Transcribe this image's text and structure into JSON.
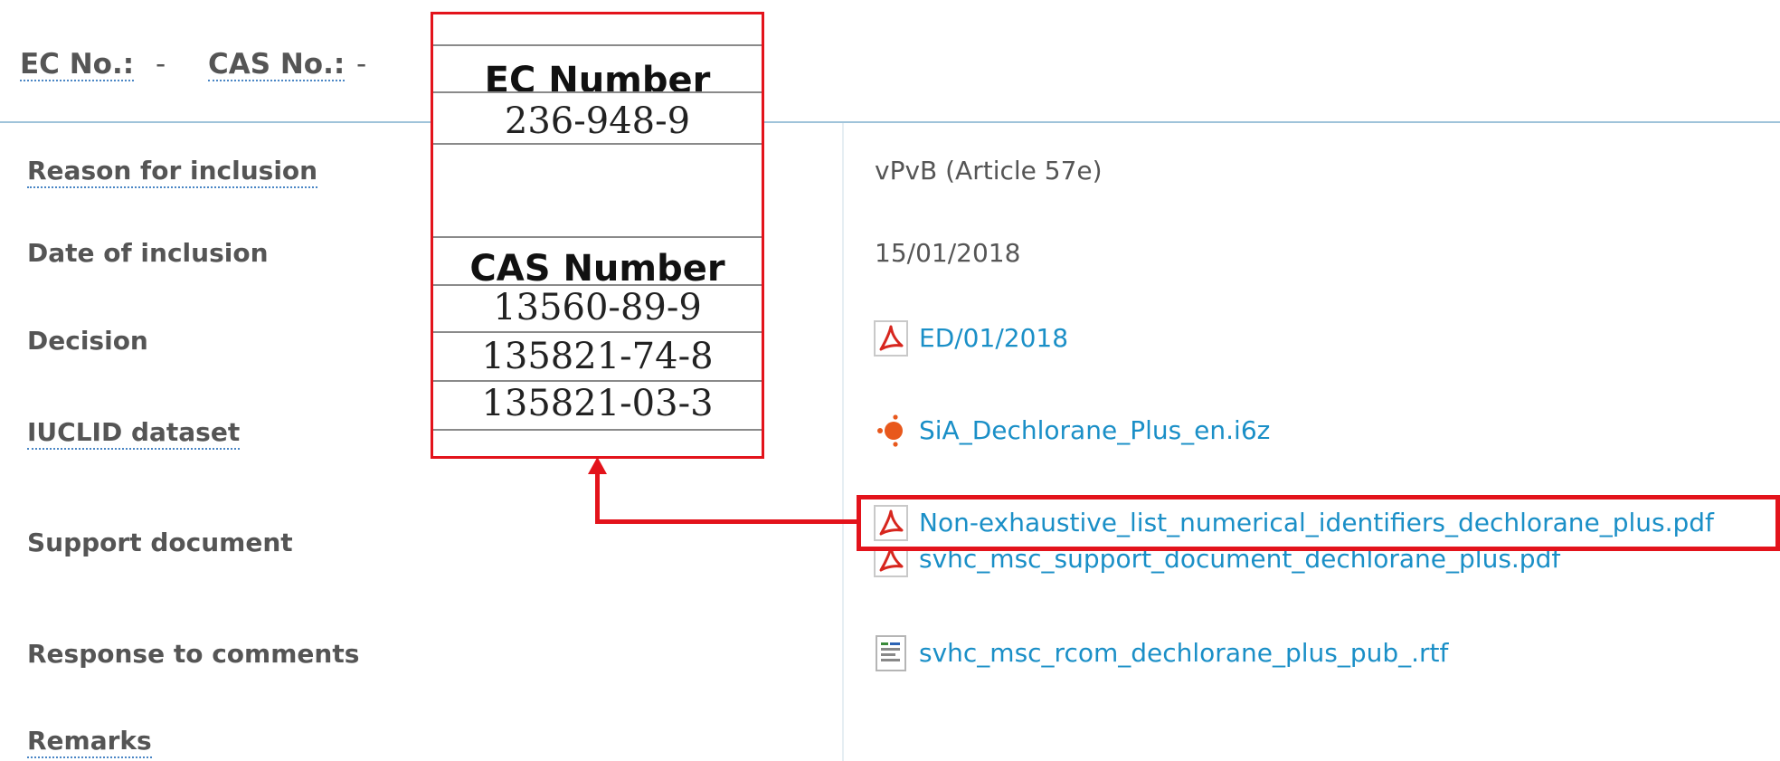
{
  "header": {
    "ec_label": "EC No.:",
    "ec_value": "-",
    "cas_label": "CAS No.:",
    "cas_value": "-"
  },
  "rows": {
    "reason": {
      "label": "Reason for inclusion",
      "value": "vPvB (Article 57e)"
    },
    "date": {
      "label": "Date of inclusion",
      "value": "15/01/2018"
    },
    "decision": {
      "label": "Decision",
      "link": "ED/01/2018",
      "icon": "pdf-icon"
    },
    "iuclid": {
      "label": "IUCLID dataset",
      "link": "SiA_Dechlorane_Plus_en.i6z",
      "icon": "iuclid-icon"
    },
    "support": {
      "label": "Support document",
      "links": [
        {
          "text": "Non-exhaustive_list_numerical_identifiers_dechlorane_plus.pdf",
          "icon": "pdf-icon"
        },
        {
          "text": "svhc_msc_support_document_dechlorane_plus.pdf",
          "icon": "pdf-icon"
        }
      ]
    },
    "response": {
      "label": "Response to comments",
      "link": "svhc_msc_rcom_dechlorane_plus_pub_.rtf",
      "icon": "rtf-icon"
    },
    "remarks": {
      "label": "Remarks"
    }
  },
  "identifiers": {
    "ec_heading": "EC Number",
    "ec_numbers": [
      "236-948-9"
    ],
    "cas_heading": "CAS Number",
    "cas_numbers": [
      "13560-89-9",
      "135821-74-8",
      "135821-03-3"
    ]
  },
  "colors": {
    "link": "#1a8fc7",
    "highlight": "#e3131b",
    "text": "#555555"
  }
}
